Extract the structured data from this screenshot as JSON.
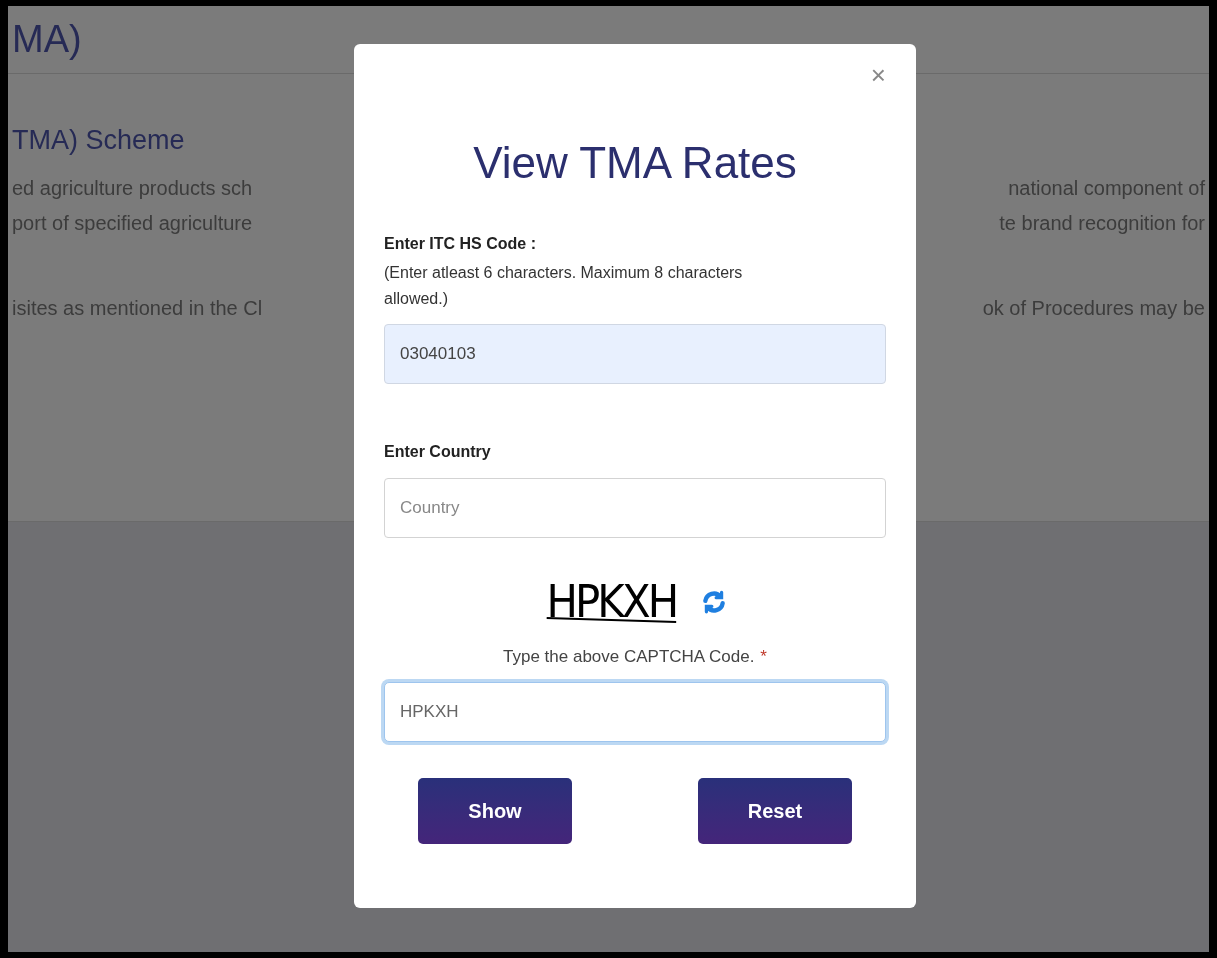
{
  "page": {
    "heading": "MA)",
    "subheading": "TMA) Scheme",
    "lines": [
      {
        "left": "ed agriculture products sch",
        "right": "national component of"
      },
      {
        "left": "port of specified agriculture",
        "right": "te brand recognition for"
      },
      {
        "left": "isites as mentioned in the Cl",
        "right": "ok of Procedures may be"
      }
    ]
  },
  "modal": {
    "close": "×",
    "title": "View TMA Rates",
    "hs_label": "Enter ITC HS Code :",
    "hs_hint": "(Enter atleast 6 characters. Maximum 8 characters allowed.)",
    "hs_value": "03040103",
    "country_label": "Enter Country",
    "country_placeholder": "Country",
    "captcha": "HPKXH",
    "captcha_prompt": "Type the above CAPTCHA Code.",
    "required_mark": "*",
    "captcha_value": "HPKXH",
    "buttons": [
      "Show",
      "Reset"
    ]
  }
}
